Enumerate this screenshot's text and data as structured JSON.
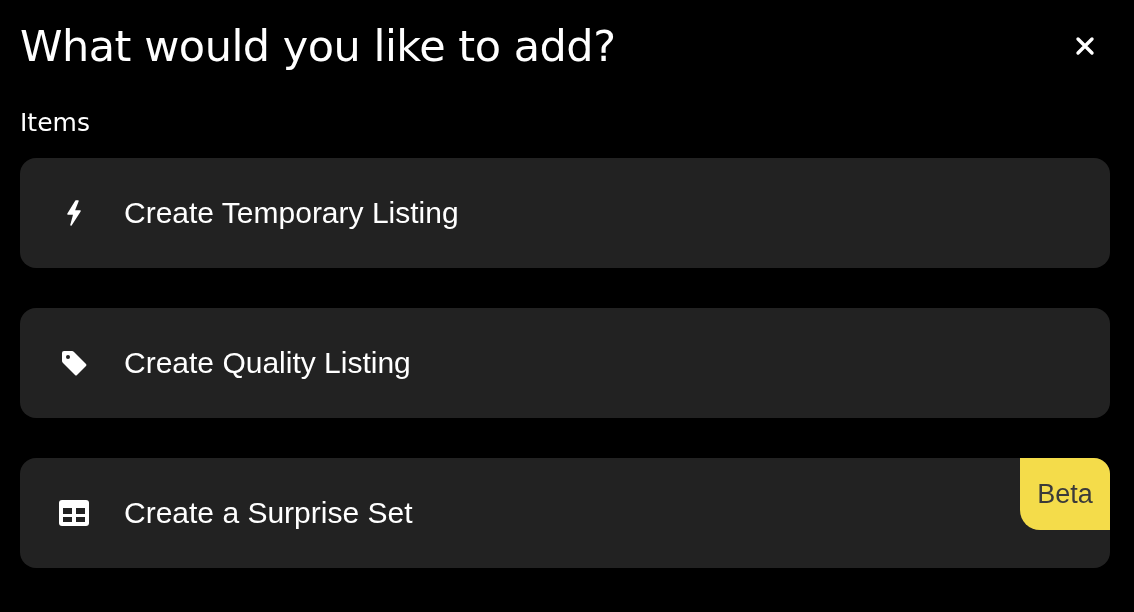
{
  "dialog": {
    "title": "What would you like to add?"
  },
  "section": {
    "heading": "Items"
  },
  "items": [
    {
      "label": "Create Temporary Listing"
    },
    {
      "label": "Create Quality Listing"
    },
    {
      "label": "Create a Surprise Set",
      "badge": "Beta"
    }
  ]
}
